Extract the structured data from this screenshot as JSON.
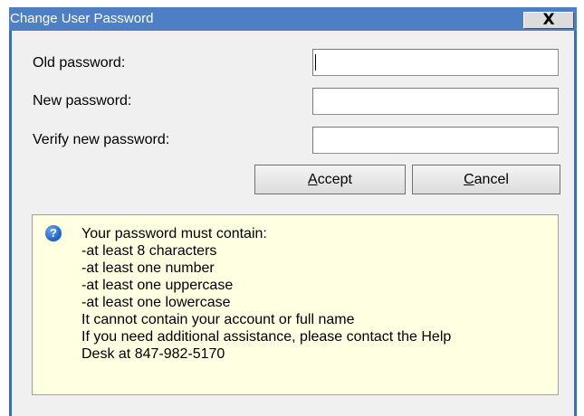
{
  "window": {
    "title": "Change User Password",
    "close_glyph": "X"
  },
  "form": {
    "old_password_label": "Old password:",
    "new_password_label": "New password:",
    "verify_password_label": "Verify new password:",
    "old_password_value": "",
    "new_password_value": "",
    "verify_password_value": ""
  },
  "buttons": {
    "accept": {
      "mnemonic": "A",
      "rest": "ccept"
    },
    "cancel": {
      "mnemonic": "C",
      "rest": "ancel"
    }
  },
  "info": {
    "icon": "help-question-icon",
    "icon_glyph": "?",
    "lines": [
      "Your password must contain:",
      "-at least 8 characters",
      "-at least one number",
      "-at least one uppercase",
      "-at least one lowercase",
      "It cannot contain your account or full name",
      "If you need additional assistance, please contact the Help",
      "Desk at 847-982-5170"
    ]
  },
  "colors": {
    "titlebar": "#4e7fc4",
    "info_background": "#ffffe1",
    "window_background": "#f0f0f0"
  }
}
